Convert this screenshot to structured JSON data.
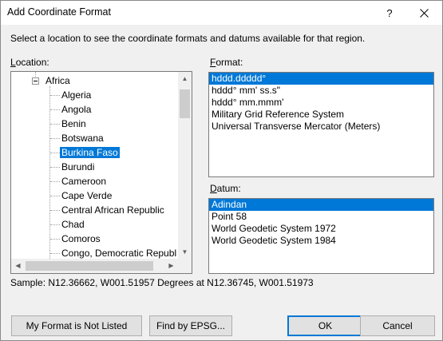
{
  "window": {
    "title": "Add Coordinate Format",
    "help": "?",
    "close_icon": "close-icon"
  },
  "instructions": "Select a location to see the coordinate formats and datums available for that region.",
  "location": {
    "label_accel": "L",
    "label_rest": "ocation:",
    "tree": {
      "root": "Africa",
      "items": [
        {
          "label": "Algeria",
          "selected": false
        },
        {
          "label": "Angola",
          "selected": false
        },
        {
          "label": "Benin",
          "selected": false
        },
        {
          "label": "Botswana",
          "selected": false
        },
        {
          "label": "Burkina Faso",
          "selected": true
        },
        {
          "label": "Burundi",
          "selected": false
        },
        {
          "label": "Cameroon",
          "selected": false
        },
        {
          "label": "Cape Verde",
          "selected": false
        },
        {
          "label": "Central African Republic",
          "selected": false
        },
        {
          "label": "Chad",
          "selected": false
        },
        {
          "label": "Comoros",
          "selected": false
        },
        {
          "label": "Congo, Democratic Republi",
          "selected": false
        }
      ]
    }
  },
  "format": {
    "label_accel": "F",
    "label_rest": "ormat:",
    "items": [
      {
        "label": "hddd.ddddd°",
        "selected": true
      },
      {
        "label": "hddd° mm' ss.s\"",
        "selected": false
      },
      {
        "label": "hddd° mm.mmm'",
        "selected": false
      },
      {
        "label": "Military Grid Reference System",
        "selected": false
      },
      {
        "label": "Universal Transverse Mercator (Meters)",
        "selected": false
      }
    ]
  },
  "datum": {
    "label_accel": "D",
    "label_rest": "atum:",
    "items": [
      {
        "label": "Adindan",
        "selected": true
      },
      {
        "label": "Point 58",
        "selected": false
      },
      {
        "label": "World Geodetic System 1972",
        "selected": false
      },
      {
        "label": "World Geodetic System 1984",
        "selected": false
      }
    ]
  },
  "sample": "Sample: N12.36662, W001.51957 Degrees at N12.36745, W001.51973",
  "buttons": {
    "not_listed": "My Format is Not Listed",
    "find_epsg": "Find by EPSG...",
    "ok": "OK",
    "cancel": "Cancel"
  },
  "colors": {
    "selection": "#0078d7",
    "dialog_bg": "#f0f0f0",
    "button_bg": "#e1e1e1"
  }
}
